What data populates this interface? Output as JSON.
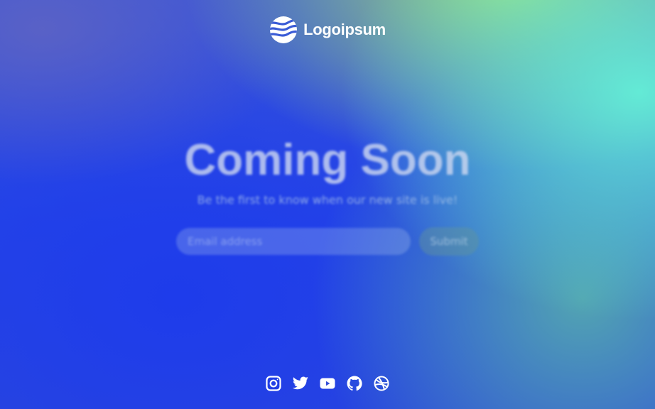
{
  "brand": {
    "name": "Logoipsum",
    "logo_icon": "wave-globe-icon"
  },
  "hero": {
    "headline": "Coming Soon",
    "tagline": "Be the first to know when our new site is live!"
  },
  "signup": {
    "email_placeholder": "Email address",
    "email_value": "",
    "submit_label": "Submit"
  },
  "socials": [
    {
      "name": "Instagram",
      "icon": "instagram-icon"
    },
    {
      "name": "Twitter",
      "icon": "twitter-icon"
    },
    {
      "name": "YouTube",
      "icon": "youtube-icon"
    },
    {
      "name": "GitHub",
      "icon": "github-icon"
    },
    {
      "name": "Dribbble",
      "icon": "dribbble-icon"
    }
  ],
  "colors": {
    "gradient_blue": "#2545e6",
    "gradient_green": "#a0e178",
    "gradient_teal": "#64f0d7",
    "text_white": "#ffffff"
  }
}
